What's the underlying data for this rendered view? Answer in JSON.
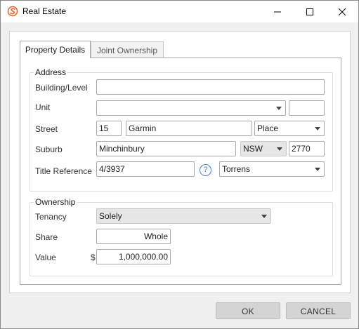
{
  "window": {
    "title": "Real Estate",
    "brand_color": "#e8652b",
    "icons": {
      "app": "app-logo-icon",
      "minimize": "minimize-icon",
      "maximize": "maximize-icon",
      "close": "close-icon"
    }
  },
  "tabs": [
    {
      "label": "Property Details",
      "active": true
    },
    {
      "label": "Joint Ownership",
      "active": false
    }
  ],
  "address": {
    "legend": "Address",
    "building_label": "Building/Level",
    "building_value": "",
    "unit_label": "Unit",
    "unit_value": "",
    "unit_extra_value": "",
    "street_label": "Street",
    "street_number": "15",
    "street_name": "Garmin",
    "street_type": "Place",
    "suburb_label": "Suburb",
    "suburb_value": "Minchinbury",
    "state_value": "NSW",
    "postcode_value": "2770",
    "title_ref_label": "Title Reference",
    "title_ref_value": "4/3937",
    "help_glyph": "?",
    "title_type_value": "Torrens"
  },
  "ownership": {
    "legend": "Ownership",
    "tenancy_label": "Tenancy",
    "tenancy_value": "Solely",
    "share_label": "Share",
    "share_value": "Whole",
    "value_label": "Value",
    "currency_symbol": "$",
    "value_amount": "1,000,000.00"
  },
  "footer": {
    "ok_label": "OK",
    "cancel_label": "CANCEL"
  }
}
